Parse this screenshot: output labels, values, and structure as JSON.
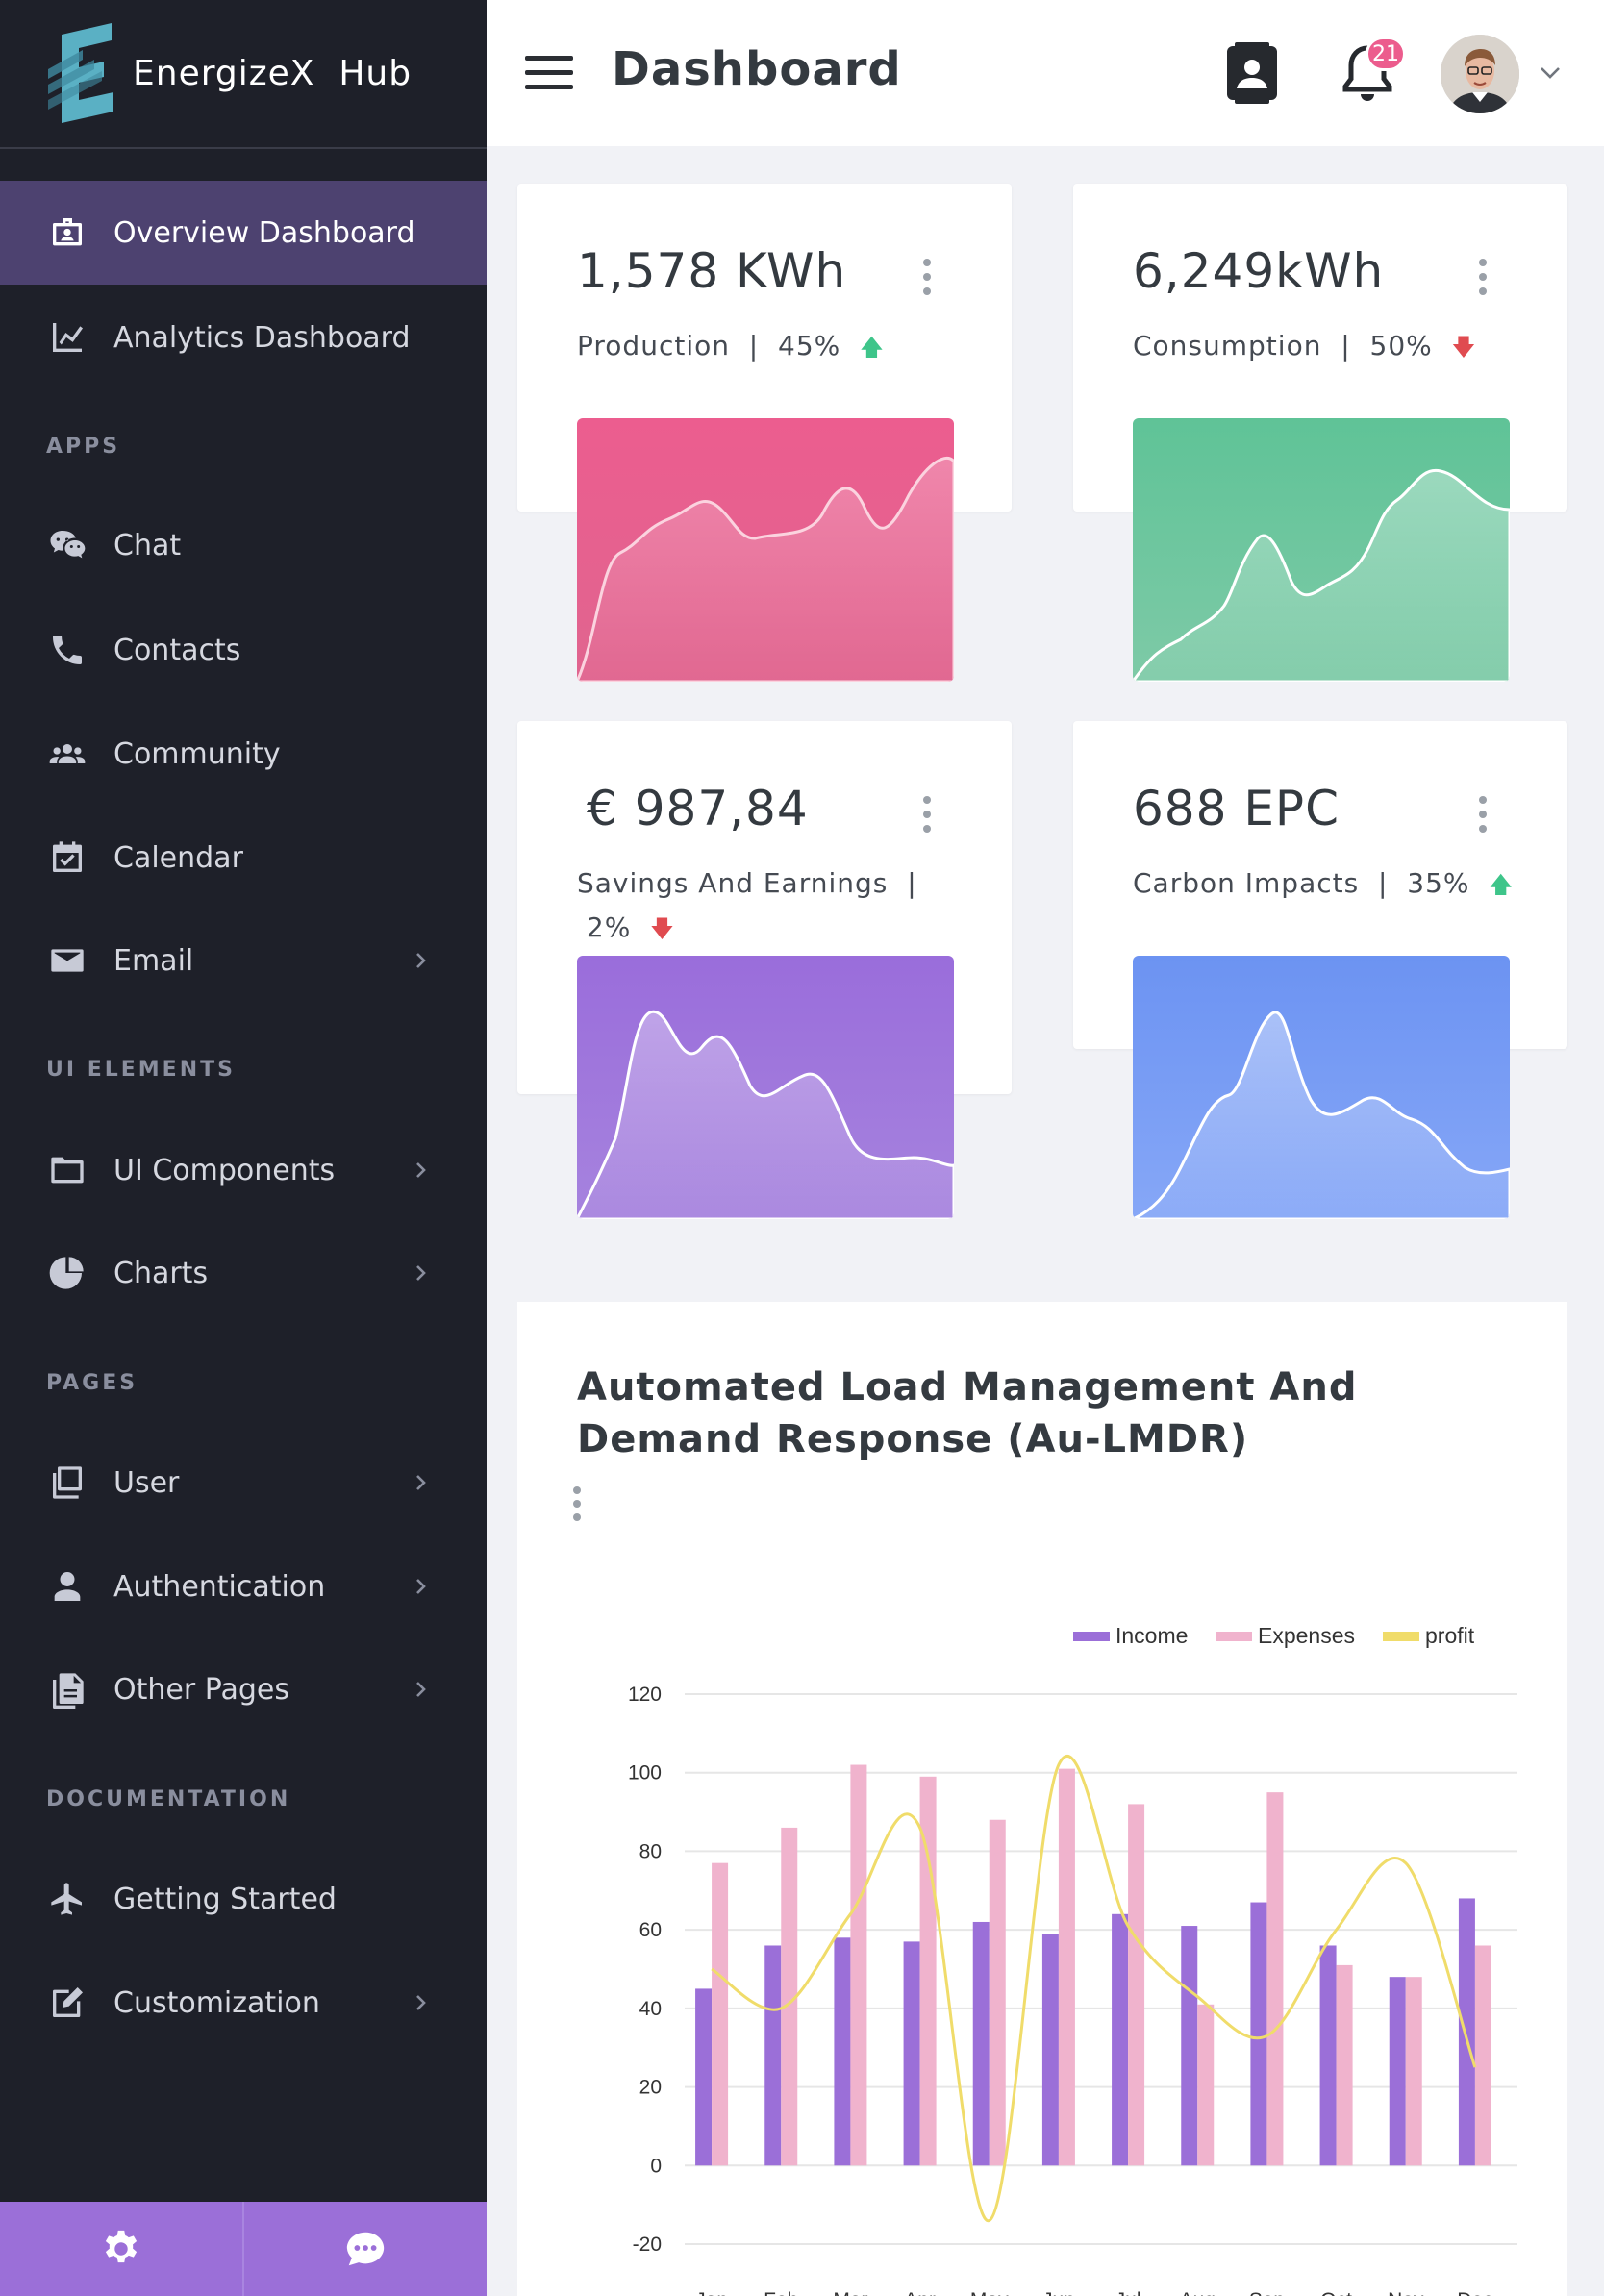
{
  "brand": {
    "name": "EnergizeX  Hub"
  },
  "header": {
    "title": "Dashboard",
    "notification_count": "21"
  },
  "sidebar": {
    "items": [
      {
        "label": "Overview Dashboard",
        "icon": "briefcase-icon",
        "active": true
      },
      {
        "label": "Analytics Dashboard",
        "icon": "line-chart-icon"
      },
      {
        "label": "Chat",
        "icon": "wechat-icon"
      },
      {
        "label": "Contacts",
        "icon": "phone-icon"
      },
      {
        "label": "Community",
        "icon": "users-icon"
      },
      {
        "label": "Calendar",
        "icon": "calendar-check-icon"
      },
      {
        "label": "Email",
        "icon": "envelope-icon",
        "chevron": true
      },
      {
        "label": "UI Components",
        "icon": "folder-icon",
        "chevron": true
      },
      {
        "label": "Charts",
        "icon": "pie-chart-icon",
        "chevron": true
      },
      {
        "label": "User",
        "icon": "copy-icon",
        "chevron": true
      },
      {
        "label": "Authentication",
        "icon": "user-icon",
        "chevron": true
      },
      {
        "label": "Other Pages",
        "icon": "file-icon",
        "chevron": true
      },
      {
        "label": "Getting Started",
        "icon": "plane-icon"
      },
      {
        "label": "Customization",
        "icon": "edit-icon",
        "chevron": true
      }
    ],
    "sections": {
      "apps": "APPS",
      "ui_elements": "UI ELEMENTS",
      "pages": "PAGES",
      "documentation": "DOCUMENTATION"
    },
    "footer": {
      "left_icon": "gear-icon",
      "right_icon": "chat-bubble-icon"
    }
  },
  "stats": [
    {
      "value": "1,578 KWh",
      "label": "Production",
      "sep": "|",
      "pct": "45%",
      "trend": "up",
      "arrow": "🡅",
      "color_top": "#ec5d8f",
      "color_bottom": "#e0658f"
    },
    {
      "value": "6,249kWh",
      "label": "Consumption",
      "sep": "|",
      "pct": "50%",
      "trend": "down",
      "arrow": "🡇",
      "color_top": "#5fc397",
      "color_bottom": "#7ecaa7"
    },
    {
      "value": "€ 987,84",
      "label": "Savings And Earnings",
      "sep": "|",
      "pct": "2%",
      "trend": "down",
      "arrow": "🡇",
      "color_top": "#9a6ddb",
      "color_bottom": "#a683de"
    },
    {
      "value": "688 EPC",
      "label": "Carbon Impacts",
      "sep": "|",
      "pct": "35%",
      "trend": "up",
      "arrow": "🡅",
      "color_top": "#6c93f2",
      "color_bottom": "#86a7f7"
    }
  ],
  "colors": {
    "accent": "#9b6fd8",
    "income": "#9b6fd8",
    "expenses": "#f0b3cd",
    "profit": "#f0dc6a",
    "up": "#3ec58a",
    "down": "#e04b50"
  },
  "chart_card": {
    "title": "Automated Load Management And Demand Response (Au-LMDR)"
  },
  "chart_data": {
    "type": "bar",
    "title": "Automated Load Management And Demand Response (Au-LMDR)",
    "categories": [
      "Jan",
      "Feb",
      "Mar",
      "Apr",
      "May",
      "Jun",
      "Jul",
      "Aug",
      "Sep",
      "Oct",
      "Nov",
      "Dec"
    ],
    "series": [
      {
        "name": "Income",
        "type": "bar",
        "values": [
          45,
          56,
          58,
          57,
          62,
          59,
          64,
          61,
          67,
          56,
          48,
          68
        ]
      },
      {
        "name": "Expenses",
        "type": "bar",
        "values": [
          77,
          86,
          102,
          99,
          88,
          101,
          92,
          41,
          95,
          51,
          48,
          56
        ]
      },
      {
        "name": "profit",
        "type": "line",
        "values": [
          50,
          40,
          64,
          86,
          -14,
          102,
          61,
          43,
          33,
          60,
          77,
          25
        ]
      }
    ],
    "ylim": [
      -20,
      120
    ],
    "yticks": [
      "120",
      "100",
      "80",
      "60",
      "40",
      "20",
      "0",
      "-20"
    ],
    "legend": "top-right",
    "grid": true
  }
}
